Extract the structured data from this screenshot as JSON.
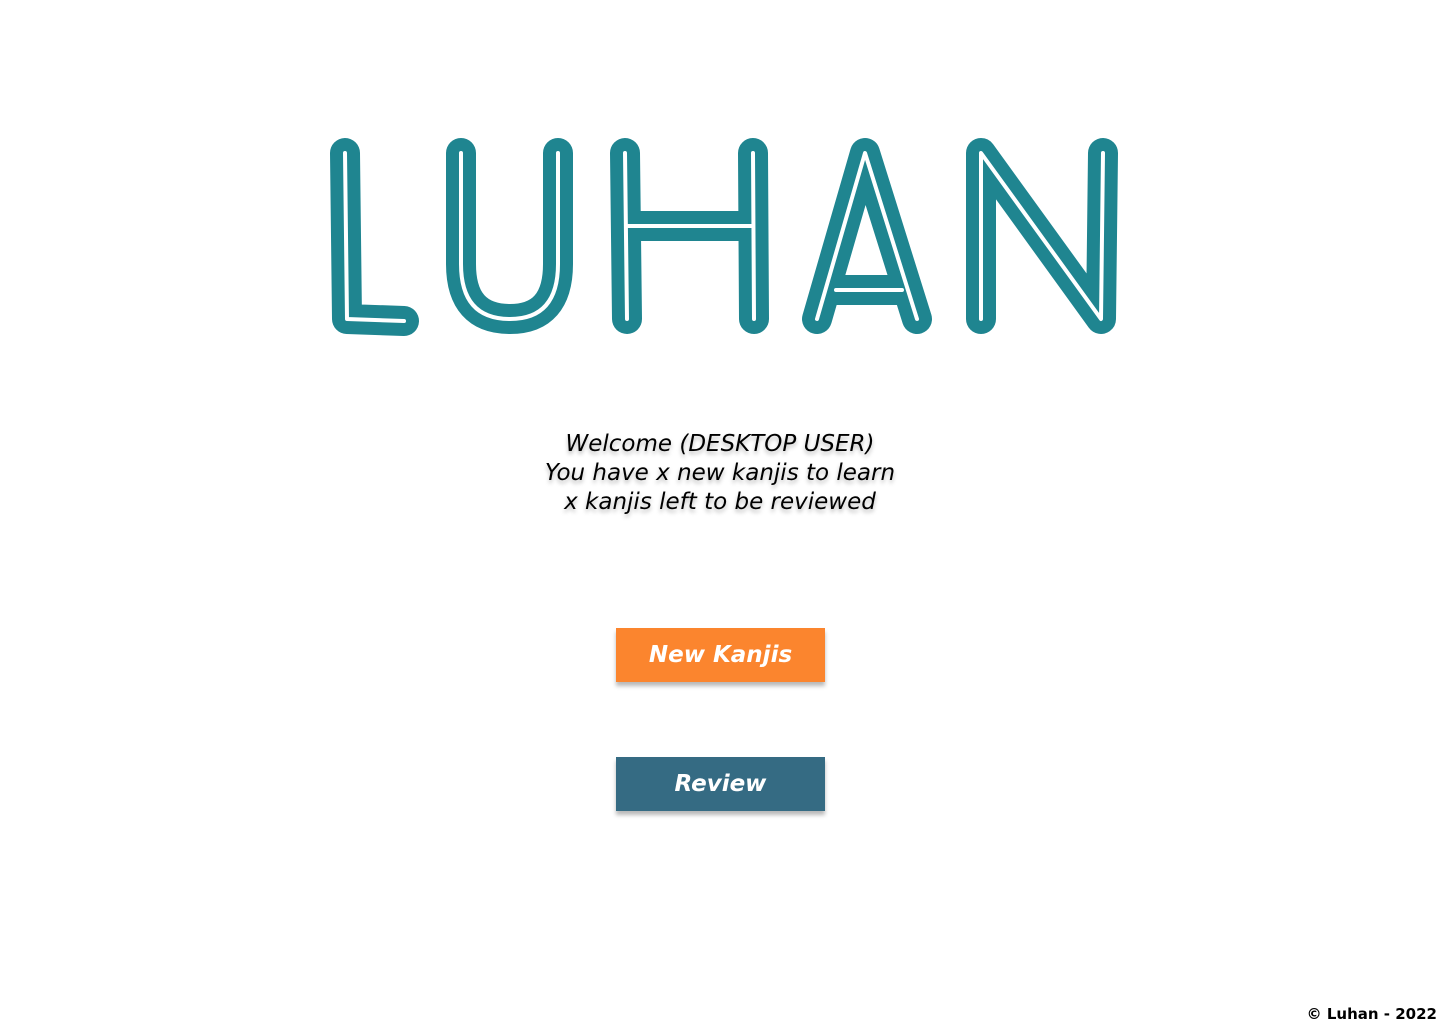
{
  "app": {
    "logo_text": "LUHAN",
    "logo_color": "#1f8590"
  },
  "welcome": {
    "line1": "Welcome (DESKTOP USER)",
    "line2": "You have x new kanjis to learn",
    "line3": "x kanjis left to be reviewed"
  },
  "actions": {
    "new_kanjis_label": "New Kanjis",
    "new_kanjis_color": "#fb852e",
    "review_label": "Review",
    "review_color": "#356b83"
  },
  "footer": {
    "copyright": "© Luhan - 2022"
  }
}
